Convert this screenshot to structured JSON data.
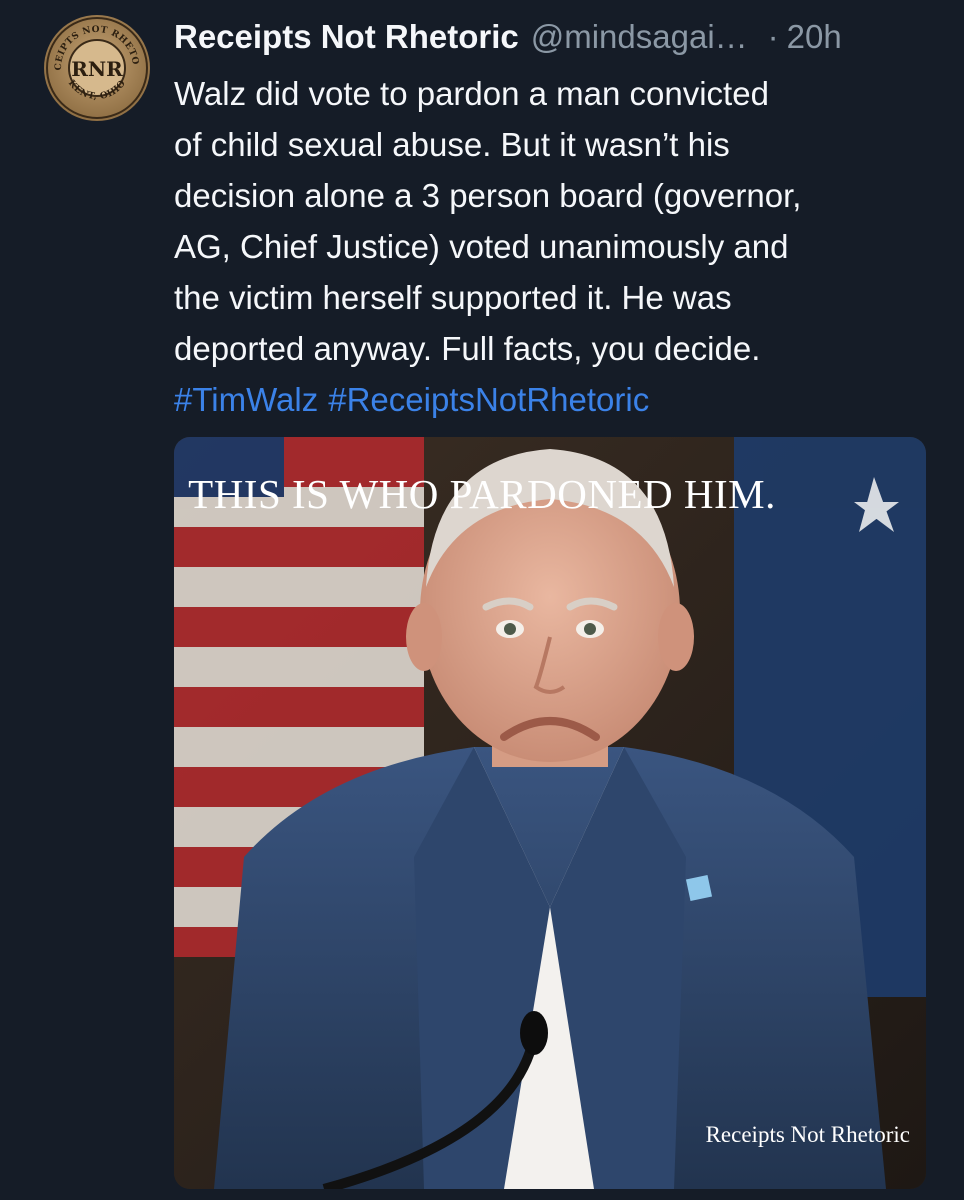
{
  "post": {
    "display_name": "Receipts Not Rhetoric",
    "handle": "@mindsagai…",
    "separator": "·",
    "timestamp": "20h",
    "avatar": {
      "initials": "RNR",
      "ring_top": "RECEIPTS NOT RHETORIC",
      "ring_bottom": "KENT, OHIO"
    },
    "body_lines": [
      "Walz did vote to pardon a man convicted",
      "of child sexual abuse. But it wasn’t his",
      "decision alone a 3 person board (governor,",
      "AG, Chief Justice) voted unanimously and",
      "the victim herself supported it. He was",
      "deported anyway. Full facts, you decide."
    ],
    "hashtags": [
      "#TimWalz",
      "#ReceiptsNotRhetoric"
    ]
  },
  "media": {
    "headline": "THIS IS WHO PARDONED HIM.",
    "watermark": "Receipts Not Rhetoric"
  },
  "colors": {
    "background": "#151c27",
    "text": "#f5f7fa",
    "muted": "#8b98a5",
    "link": "#3b82e8"
  }
}
